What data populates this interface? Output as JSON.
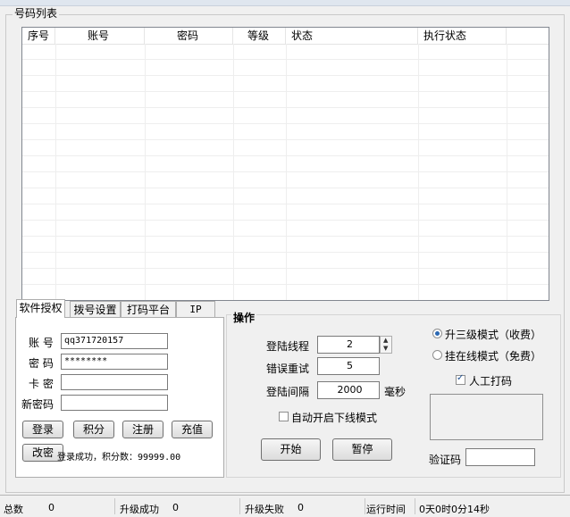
{
  "list_group": {
    "title": "号码列表"
  },
  "table": {
    "columns": [
      "序号",
      "账号",
      "密码",
      "等级",
      "状态",
      "执行状态",
      ""
    ]
  },
  "tabs": [
    "软件授权",
    "拨号设置",
    "打码平台",
    "IP"
  ],
  "auth": {
    "account_label": "账 号",
    "account_value": "qq371720157",
    "password_label": "密 码",
    "password_value": "********",
    "card_label": "卡 密",
    "card_value": "",
    "newpwd_label": "新密码",
    "newpwd_value": "",
    "login_btn": "登录",
    "points_btn": "积分",
    "register_btn": "注册",
    "recharge_btn": "充值",
    "changepwd_btn": "改密",
    "status_text": "登录成功，积分数：99999.00"
  },
  "operation": {
    "title": "操作",
    "threads_label": "登陆线程",
    "threads_value": "2",
    "retry_label": "错误重试",
    "retry_value": "5",
    "interval_label": "登陆间隔",
    "interval_value": "2000",
    "interval_unit": "毫秒",
    "auto_offline_label": "自动开启下线模式",
    "auto_offline_checked": false,
    "start_btn": "开始",
    "pause_btn": "暂停",
    "mode_paid_label": "升三级模式（收费）",
    "mode_paid_selected": true,
    "mode_free_label": "挂在线模式（免费）",
    "mode_free_selected": false,
    "manual_captcha_label": "人工打码",
    "manual_captcha_checked": true,
    "captcha_label": "验证码",
    "captcha_value": ""
  },
  "statusbar": {
    "total_label": "总数",
    "total_value": "0",
    "success_label": "升级成功",
    "success_value": "0",
    "fail_label": "升级失败",
    "fail_value": "0",
    "runtime_label": "运行时间",
    "runtime_value": "0天0时0分14秒"
  }
}
